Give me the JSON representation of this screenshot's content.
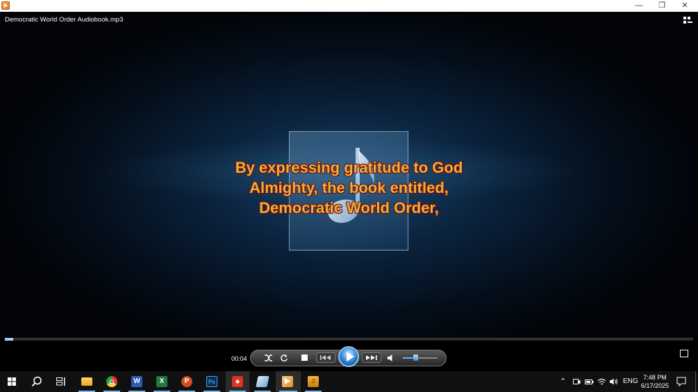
{
  "window": {
    "icon": "media-player-icon",
    "controls": [
      "minimize",
      "maximize",
      "close"
    ]
  },
  "player": {
    "filename": "Democratic World Order Audiobook.mp3",
    "lyrics": [
      "By expressing gratitude to God",
      "Almighty, the book entitled,",
      "Democratic World Order,"
    ],
    "elapsed": "00:04",
    "progress_fraction": 0.012,
    "volume_fraction": 0.35
  },
  "taskbar": {
    "apps": [
      "start",
      "search",
      "task-view",
      "file-explorer",
      "chrome",
      "word",
      "excel",
      "powerpoint",
      "photoshop",
      "app-red",
      "app-blue",
      "media-player",
      "app-music"
    ],
    "tray": {
      "language": "ENG",
      "time": "7:48 PM",
      "date": "6/17/2025"
    }
  },
  "colors": {
    "lyrics_fill": "#e8b23a",
    "lyrics_outline": "#7a1010",
    "accent": "#2f7fd0"
  }
}
